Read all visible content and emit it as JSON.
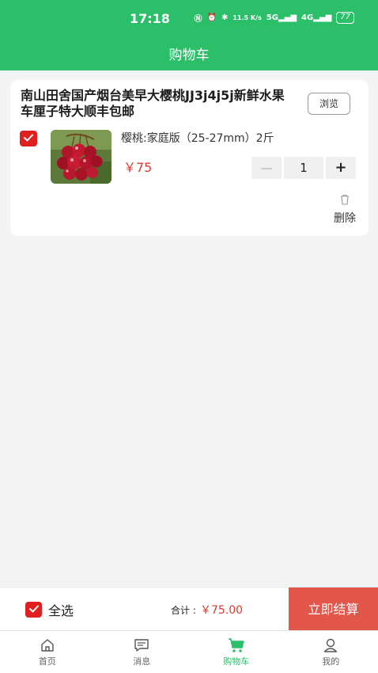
{
  "status": {
    "time": "17:18",
    "icons": [
      "nfc-icon",
      "alarm-icon",
      "bluetooth-icon",
      "data-speed-icon",
      "5g-signal-icon",
      "4g-signal-icon",
      "battery-icon"
    ],
    "speed": "11.5 K/s",
    "net1": "5G",
    "net2": "4G",
    "battery": "77"
  },
  "header": {
    "title": "购物车"
  },
  "cart_item": {
    "title": "南山田舍国产烟台美早大樱桃JJ3j4j5j新鲜水果车厘子特大顺丰包邮",
    "browse_label": "浏览",
    "checked": true,
    "spec": "樱桃:家庭版（25-27mm）2斤",
    "price": "￥75",
    "quantity": "1",
    "minus_label": "—",
    "plus_label": "+",
    "delete_label": "删除"
  },
  "bottom_bar": {
    "select_all_label": "全选",
    "select_all_checked": true,
    "total_label": "合计 :",
    "total_value": "￥75.00",
    "checkout_label": "立即结算"
  },
  "tabbar": {
    "items": [
      {
        "label": "首页",
        "icon": "home-icon",
        "active": false
      },
      {
        "label": "消息",
        "icon": "message-icon",
        "active": false
      },
      {
        "label": "购物车",
        "icon": "cart-icon",
        "active": true
      },
      {
        "label": "我的",
        "icon": "user-icon",
        "active": false
      }
    ]
  },
  "colors": {
    "brand_green": "#2cbf6a",
    "checkout_red": "#e3564a",
    "price_red": "#e03a2e",
    "checkbox_red": "#e02020"
  }
}
